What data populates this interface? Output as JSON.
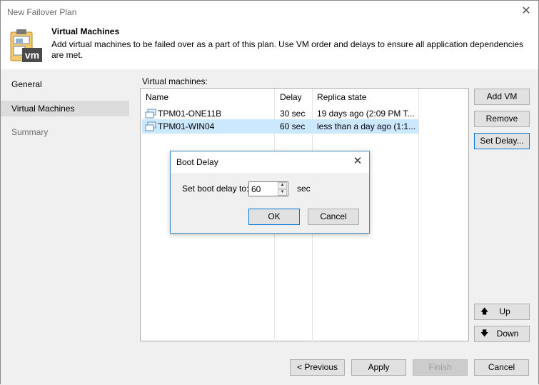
{
  "window": {
    "title": "New Failover Plan",
    "close_glyph": "✕"
  },
  "header": {
    "title": "Virtual Machines",
    "description": "Add virtual machines to be failed over as a part of this plan. Use VM order and delays to ensure all application dependencies are met.",
    "icon": "vm-clipboard-icon",
    "icon_text": "vm"
  },
  "sidebar": {
    "items": [
      {
        "label": "General",
        "state": "normal"
      },
      {
        "label": "Virtual Machines",
        "state": "selected"
      },
      {
        "label": "Summary",
        "state": "dim"
      }
    ]
  },
  "content": {
    "list_label": "Virtual machines:",
    "columns": [
      "Name",
      "Delay",
      "Replica state"
    ],
    "rows": [
      {
        "name": "TPM01-ONE11B",
        "delay": "30 sec",
        "replica_state": "19 days ago (2:09 PM T...",
        "selected": false
      },
      {
        "name": "TPM01-WIN04",
        "delay": "60 sec",
        "replica_state": "less than a day ago (1:1...",
        "selected": true
      }
    ],
    "buttons": {
      "add_vm": "Add VM",
      "remove": "Remove",
      "set_delay": "Set Delay...",
      "up": "Up",
      "down": "Down"
    }
  },
  "footer": {
    "previous": "< Previous",
    "apply": "Apply",
    "finish": "Finish",
    "cancel": "Cancel"
  },
  "dialog": {
    "title": "Boot Delay",
    "label": "Set boot delay to:",
    "value": "60",
    "unit": "sec",
    "ok": "OK",
    "cancel": "Cancel",
    "close_glyph": "✕"
  },
  "colors": {
    "selection": "#cce8ff",
    "sidebar_selected": "#dcdcdc",
    "panel": "#f0f0f0",
    "focus_border": "#0078d7"
  }
}
